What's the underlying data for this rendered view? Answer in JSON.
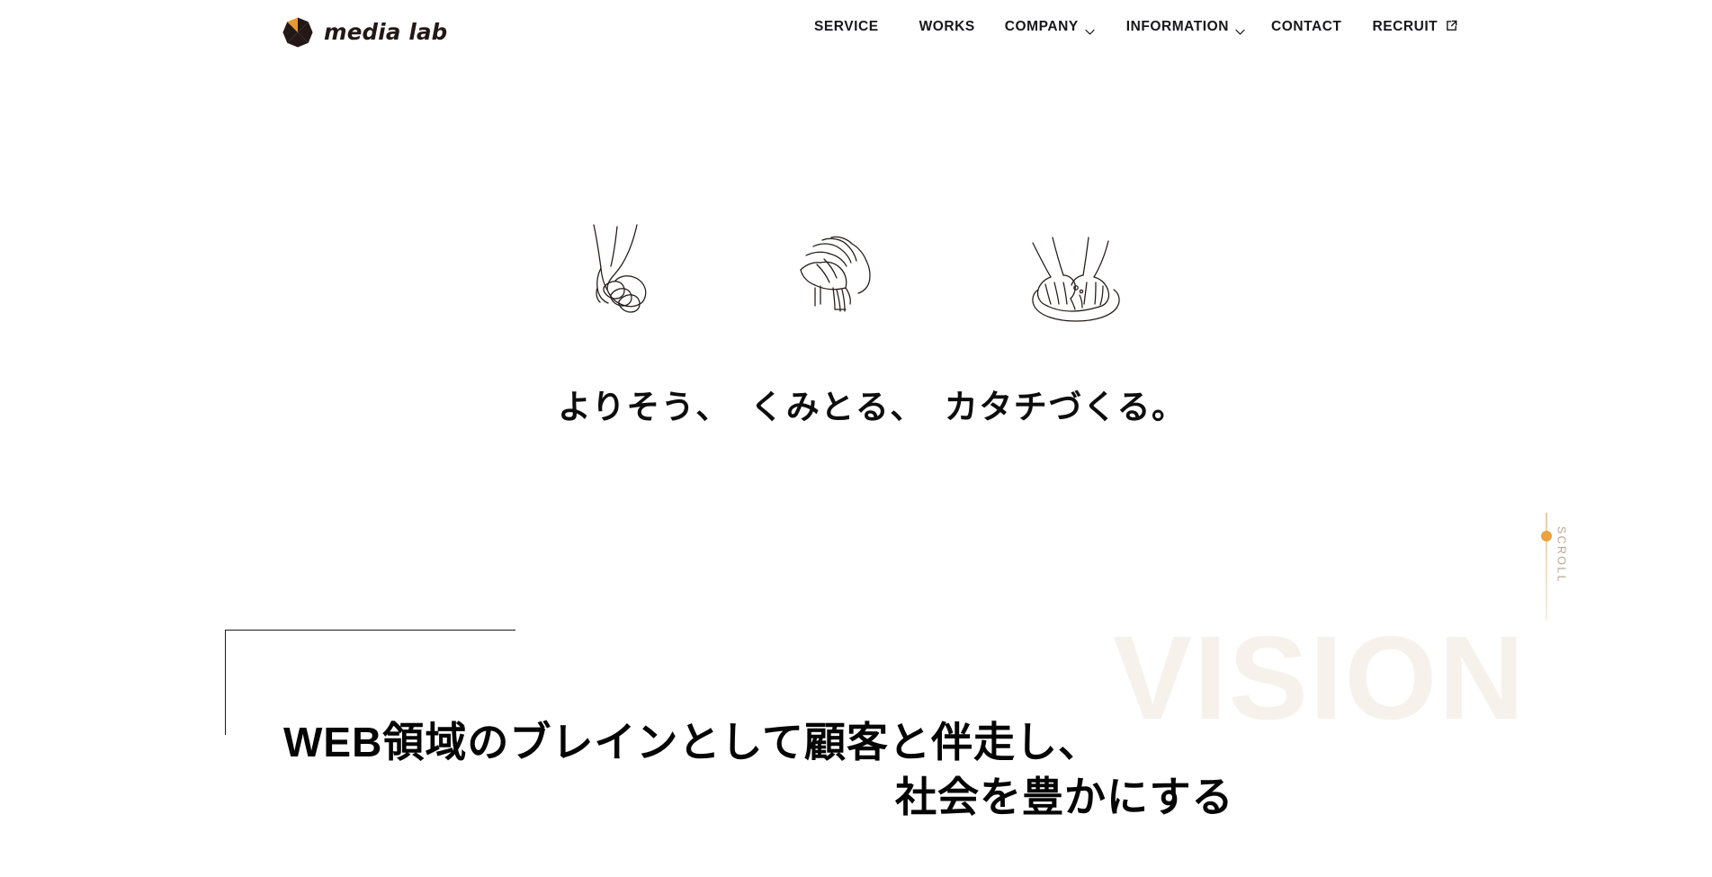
{
  "header": {
    "brand": {
      "word": "media lab",
      "mark_colors": {
        "accent": "#E89A2E",
        "dark": "#231815"
      }
    },
    "nav": [
      {
        "label": "SERVICE",
        "has_dropdown": false,
        "external": false
      },
      {
        "label": "WORKS",
        "has_dropdown": false,
        "external": false
      },
      {
        "label": "COMPANY",
        "has_dropdown": true,
        "external": false,
        "icon": "chevron-down-icon"
      },
      {
        "label": "INFORMATION",
        "has_dropdown": true,
        "external": false,
        "icon": "chevron-down-icon"
      },
      {
        "label": "CONTACT",
        "has_dropdown": false,
        "external": false
      },
      {
        "label": "RECRUIT",
        "has_dropdown": false,
        "external": true,
        "icon": "external-link-icon"
      }
    ]
  },
  "hero": {
    "illustrations": [
      {
        "name": "clasped-hands-illustration"
      },
      {
        "name": "cupped-listening-hands-illustration"
      },
      {
        "name": "shaping-hands-illustration"
      }
    ],
    "tagline": {
      "part_1": "よりそう、",
      "part_2": "くみとる、",
      "part_3": "カタチづくる。"
    }
  },
  "scroll": {
    "label": "SCROLL",
    "dot_color": "#EBA23F",
    "rail_color": "#E3CCAB"
  },
  "vision": {
    "watermark": "VISION",
    "watermark_color": "#F7F1EC",
    "heading_line_1": "WEB領域のブレインとして顧客と伴走し、",
    "heading_line_2": "社会を豊かにする"
  }
}
